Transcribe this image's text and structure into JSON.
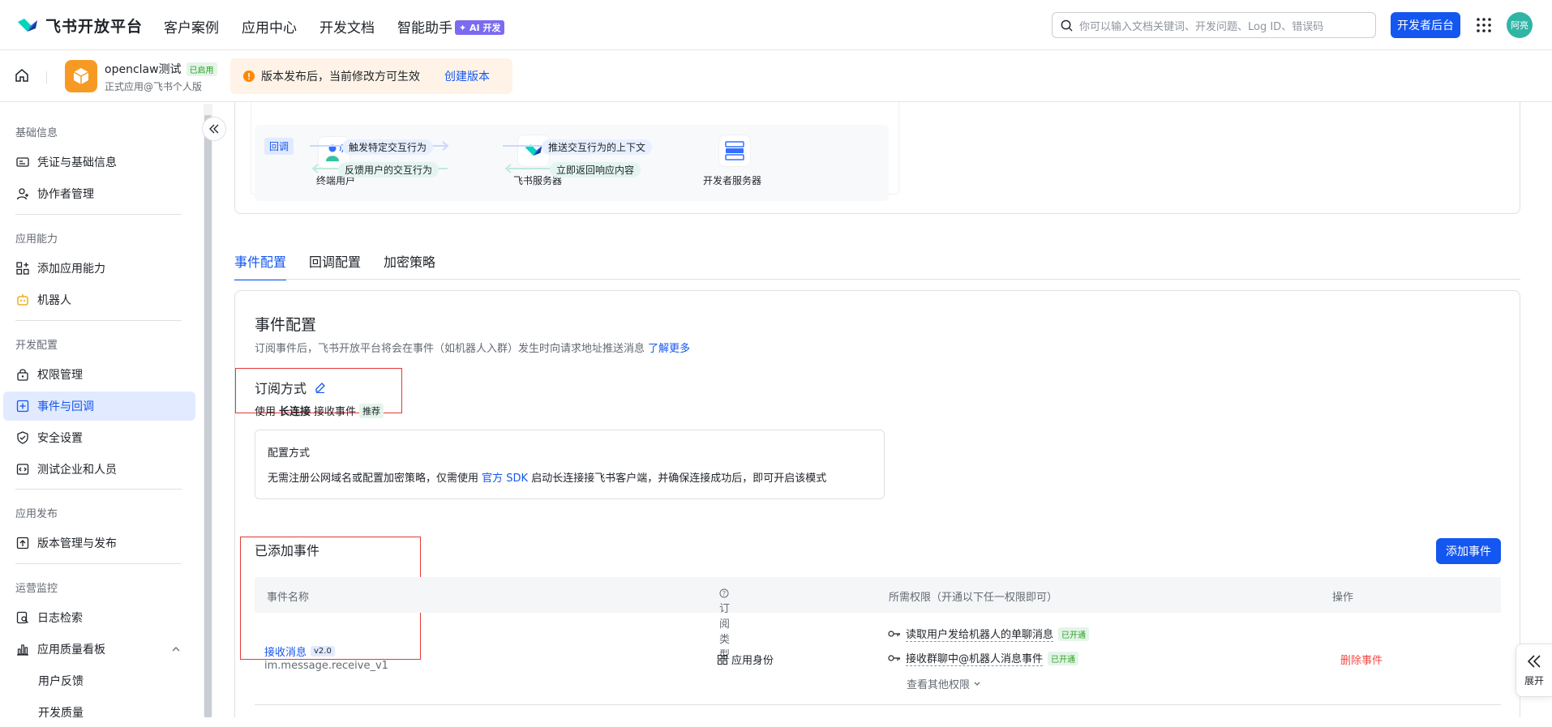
{
  "topbar": {
    "brand": "飞书开放平台",
    "nav": [
      "客户案例",
      "应用中心",
      "开发文档",
      "智能助手"
    ],
    "ai_badge": "✦ AI 开发",
    "search_placeholder": "你可以输入文档关键词、开发问题、Log ID、错误码",
    "dev_console": "开发者后台",
    "avatar": "阿亮",
    "brand_color": "#1456f0"
  },
  "app": {
    "name": "openclaw测试",
    "status": "已启用",
    "sub": "正式应用@飞书个人版"
  },
  "notice": {
    "text": "版本发布后，当前修改方可生效",
    "link": "创建版本"
  },
  "sidebar": {
    "sections": [
      {
        "title": "基础信息",
        "items": [
          "凭证与基础信息",
          "协作者管理"
        ]
      },
      {
        "title": "应用能力",
        "items": [
          "添加应用能力",
          "机器人"
        ]
      },
      {
        "title": "开发配置",
        "items": [
          "权限管理",
          "事件与回调",
          "安全设置",
          "测试企业和人员"
        ]
      },
      {
        "title": "应用发布",
        "items": [
          "版本管理与发布"
        ]
      },
      {
        "title": "运营监控",
        "items": [
          "日志检索",
          "应用质量看板",
          "用户反馈",
          "开发质量"
        ]
      }
    ],
    "active": "事件与回调"
  },
  "flow": {
    "tag": "回调",
    "end_user": "终端用户",
    "feishu_server": "飞书服务器",
    "dev_server": "开发者服务器",
    "arrow1": "触发特定交互行为",
    "arrow2": "反馈用户的交互行为",
    "arrow3": "推送交互行为的上下文",
    "arrow4": "立即返回响应内容"
  },
  "tabs": [
    "事件配置",
    "回调配置",
    "加密策略"
  ],
  "event_config": {
    "title": "事件配置",
    "desc": "订阅事件后，飞书开放平台将会在事件（如机器人入群）发生时向请求地址推送消息",
    "learn_more": "了解更多",
    "sub_mode_title": "订阅方式",
    "use": "使用",
    "long_conn": "长连接",
    "receive": "接收事件",
    "recommended": "推荐",
    "cfg_title": "配置方式",
    "cfg_desc_1": "无需注册公网域名或配置加密策略，仅需使用",
    "cfg_link": "官方 SDK",
    "cfg_desc_2": "启动长连接接飞书客户端，并确保连接成功后，即可开启该模式"
  },
  "added_events": {
    "title": "已添加事件",
    "add_button": "添加事件",
    "columns": [
      "事件名称",
      "订阅类型",
      "所需权限（开通以下任一权限即可）",
      "操作"
    ],
    "rows": [
      {
        "name": "接收消息",
        "version": "v2.0",
        "code": "im.message.receive_v1",
        "type": "应用身份",
        "perms": [
          {
            "text": "读取用户发给机器人的单聊消息",
            "status": "已开通"
          },
          {
            "text": "接收群聊中@机器人消息事件",
            "status": "已开通"
          }
        ],
        "more": "查看其他权限",
        "action": "删除事件"
      }
    ]
  },
  "expand": "展开"
}
